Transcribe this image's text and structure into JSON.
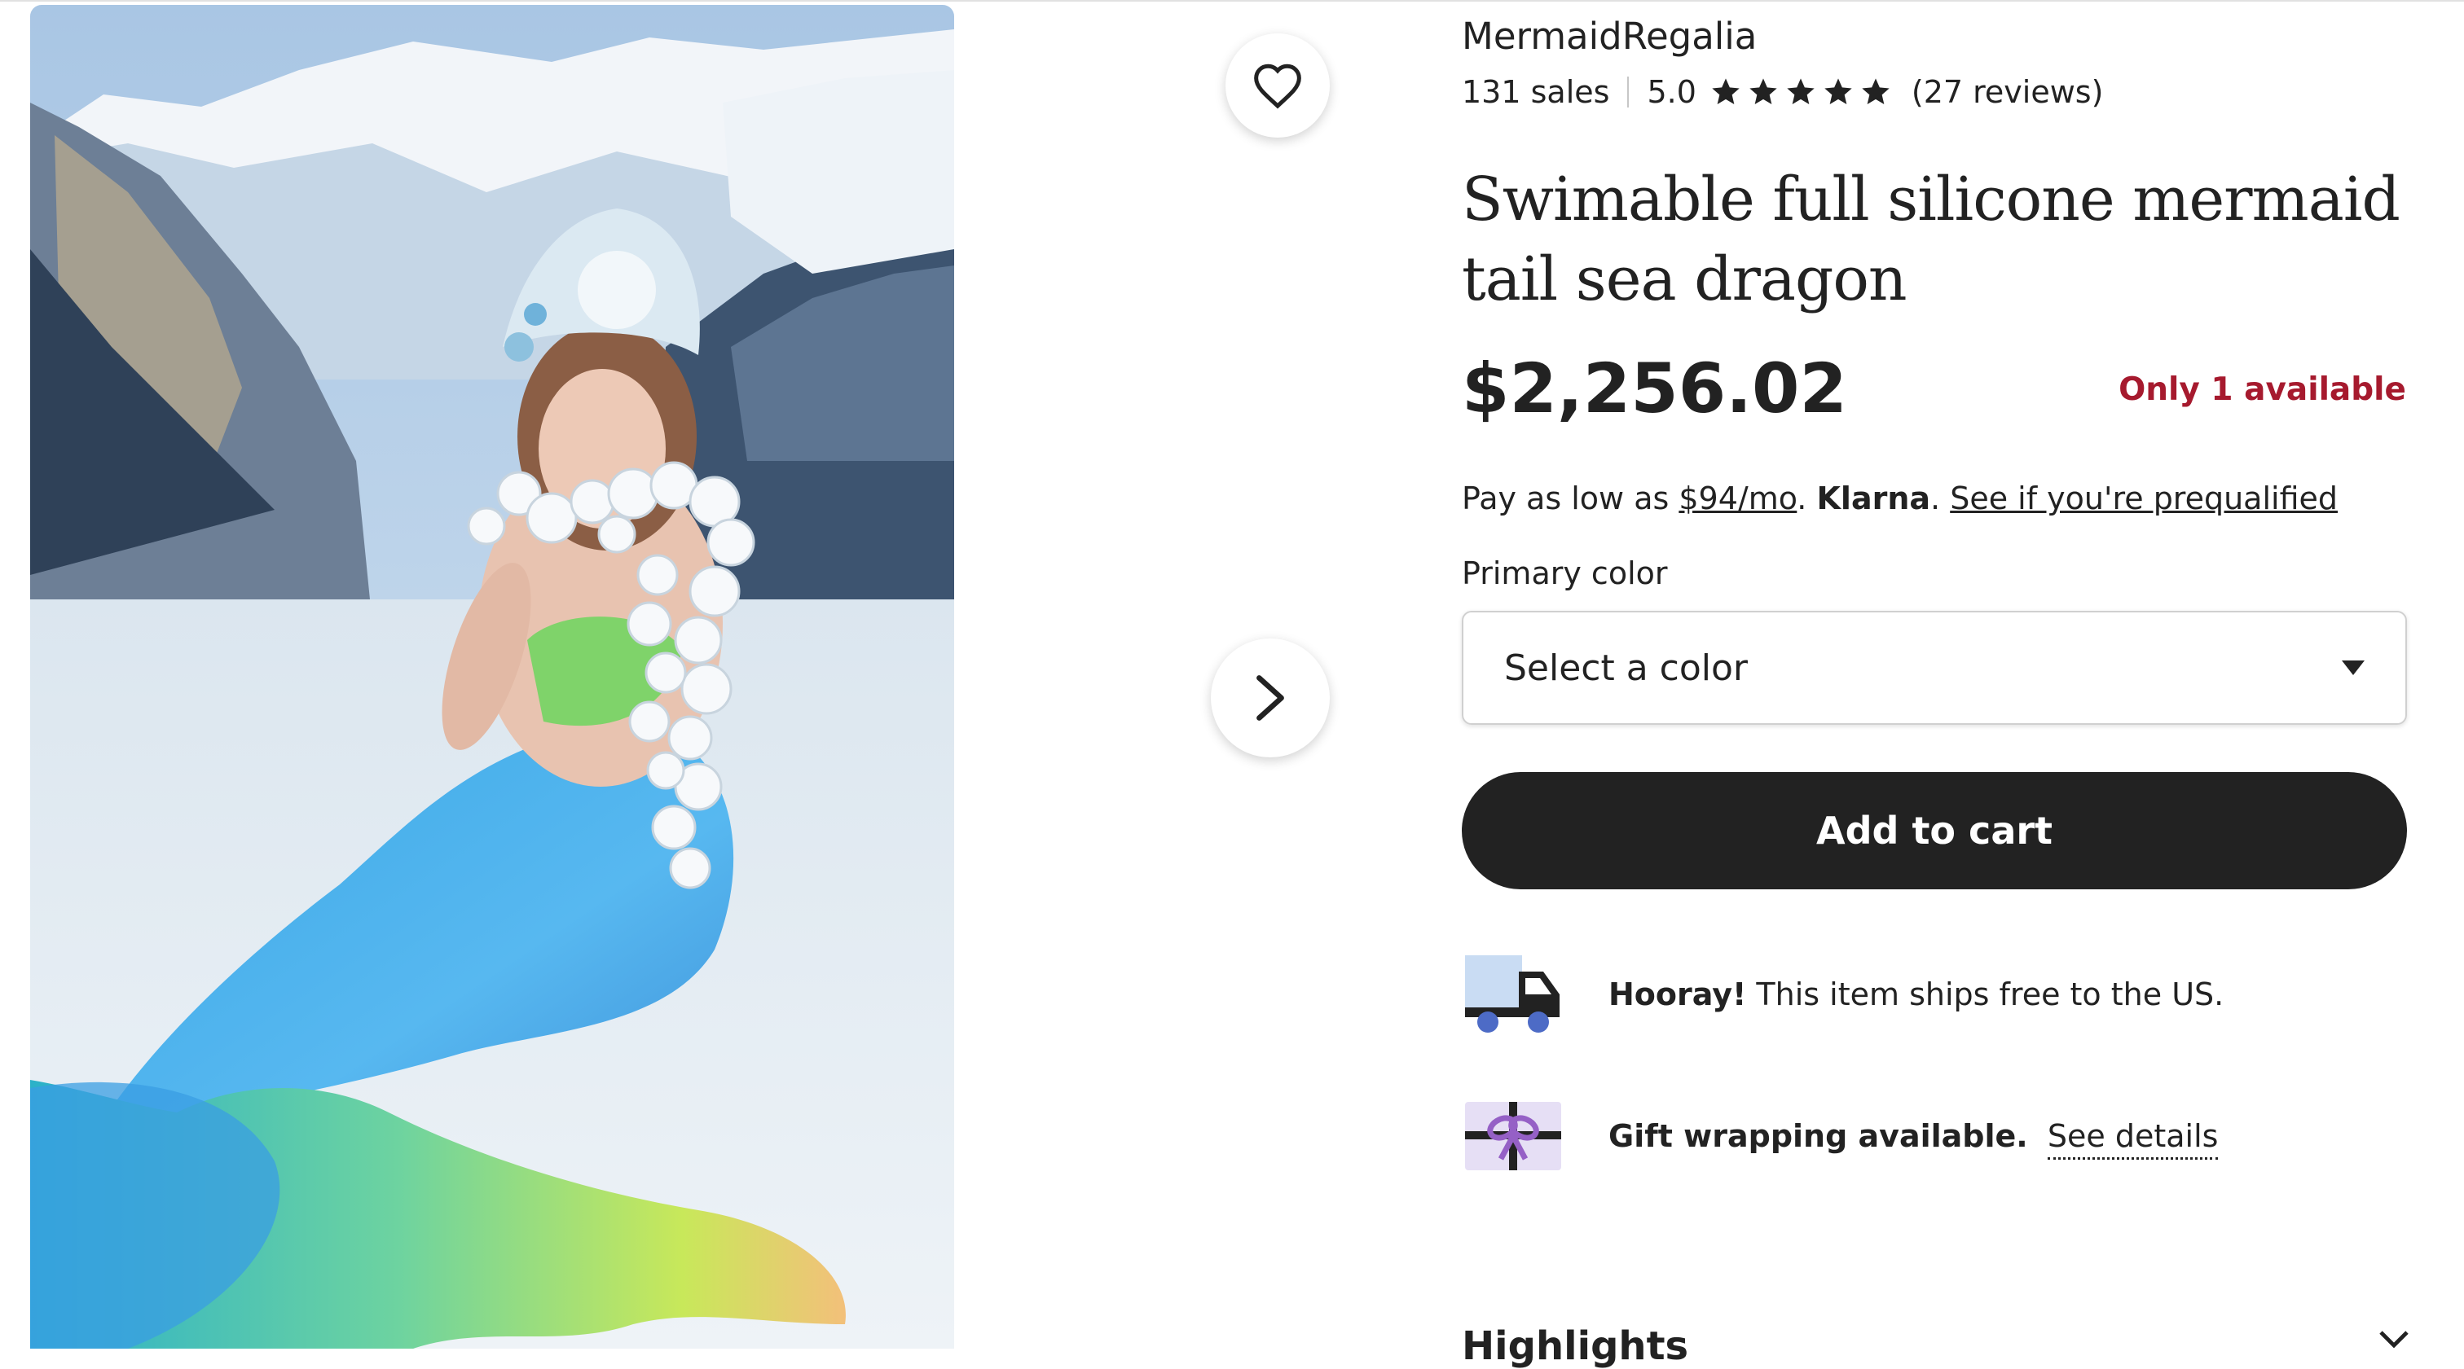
{
  "shop": {
    "name": "MermaidRegalia",
    "sales": "131 sales",
    "rating": "5.0",
    "stars": 5,
    "reviews": "(27 reviews)"
  },
  "listing": {
    "title": "Swimable full silicone mermaid tail sea dragon",
    "price": "$2,256.02",
    "stock": "Only 1 available"
  },
  "klarna": {
    "prefix": "Pay as low as ",
    "amount": "$94/mo",
    "after_amount": ". ",
    "brand": "Klarna",
    "after_brand": ". ",
    "link": "See if you're prequalified"
  },
  "variation": {
    "label": "Primary color",
    "placeholder": "Select a color"
  },
  "actions": {
    "add_to_cart": "Add to cart"
  },
  "perks": {
    "shipping_bold": "Hooray!",
    "shipping_text": " This item ships free to the US.",
    "gift_bold": "Gift wrapping available.",
    "gift_link": "See details"
  },
  "section_heading": "Highlights",
  "colors": {
    "text": "#222222",
    "stock_red": "#a61a2e",
    "button_dark": "#222222",
    "truck_body": "#222222",
    "truck_box": "#c9dcf3",
    "wheel_blue": "#4d6bc6",
    "gift_purple": "#9560c6"
  },
  "icons": [
    "heart-icon",
    "chevron-right-icon",
    "star-icon",
    "dropdown-caret-icon",
    "truck-icon",
    "gift-icon",
    "chevron-down-icon"
  ]
}
